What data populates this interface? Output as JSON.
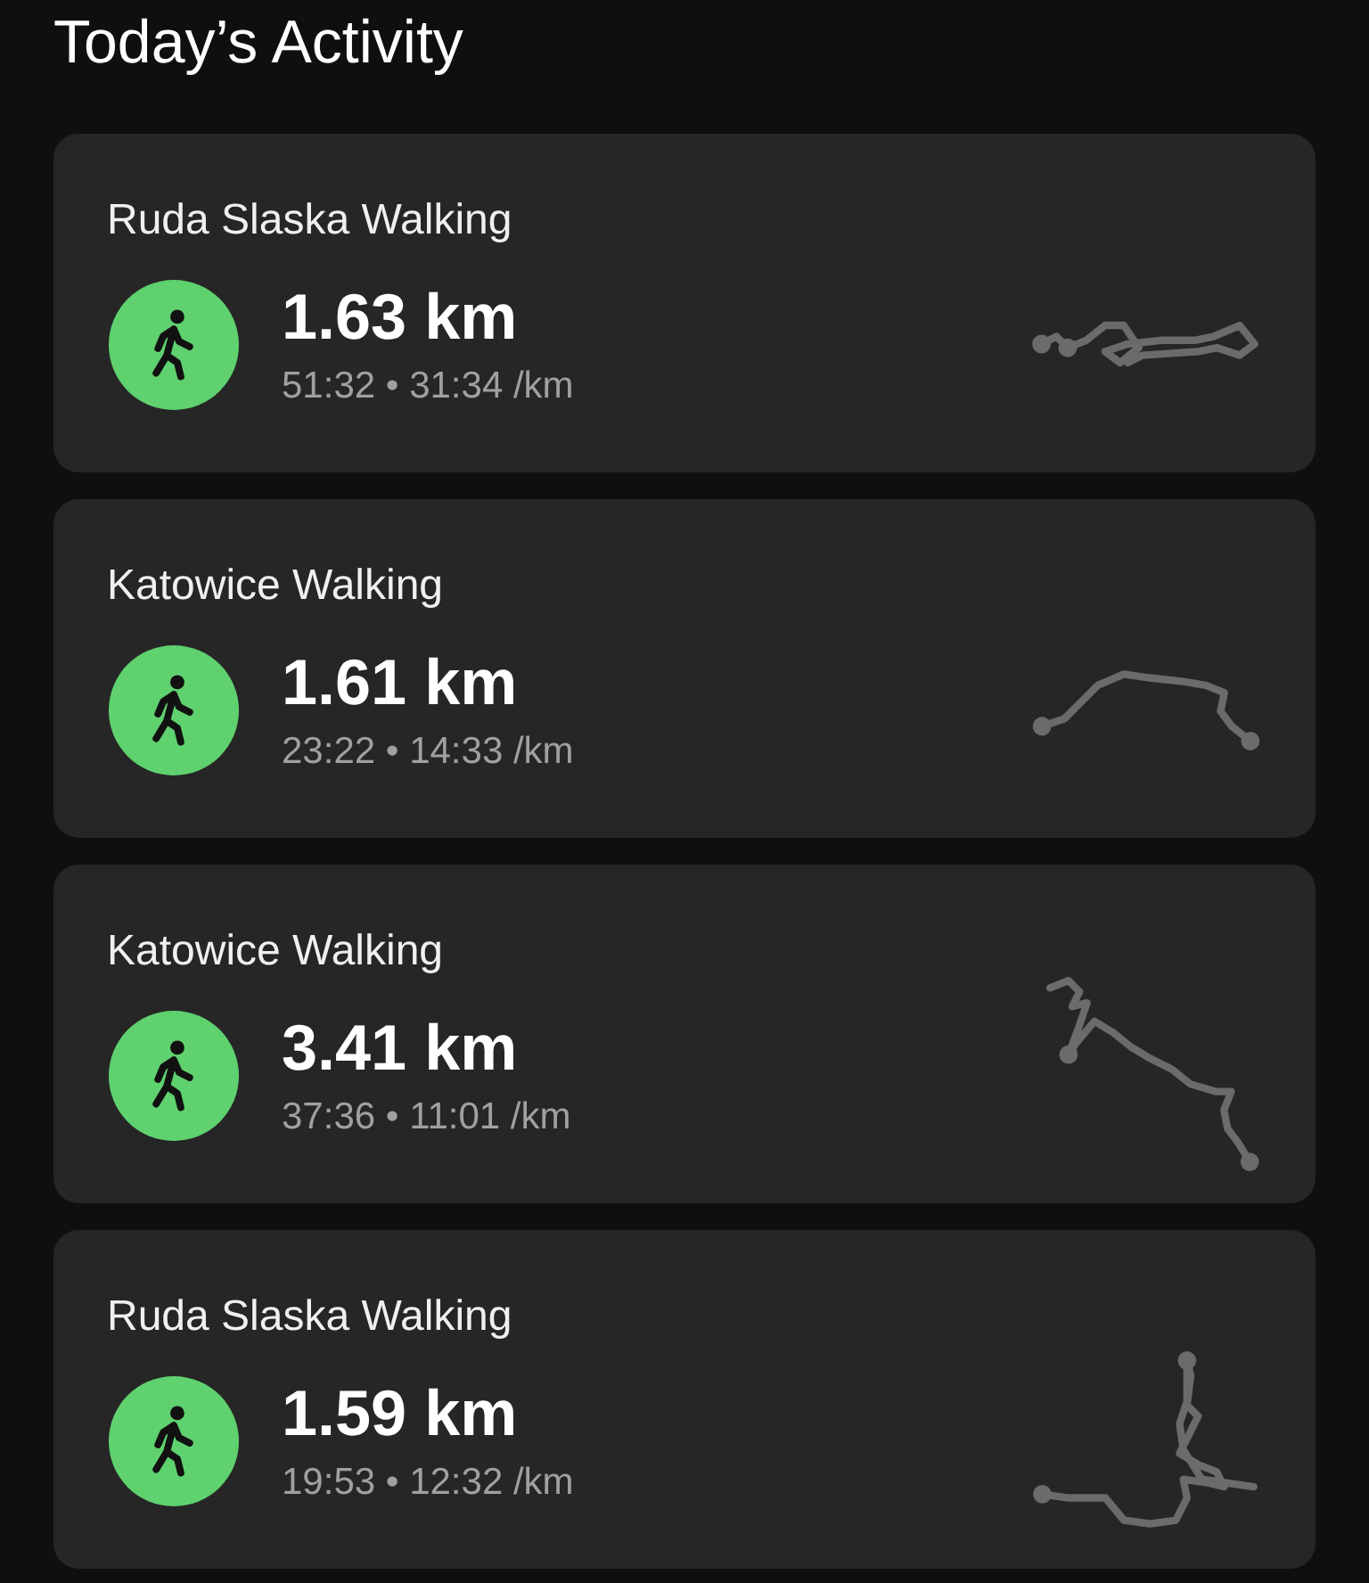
{
  "title": "Today’s Activity",
  "activities": [
    {
      "name": "Ruda Slaska Walking",
      "distance": "1.63 km",
      "details": "51:32 • 31:34 /km"
    },
    {
      "name": "Katowice Walking",
      "distance": "1.61 km",
      "details": "23:22 • 14:33 /km"
    },
    {
      "name": "Katowice Walking",
      "distance": "3.41 km",
      "details": "37:36 • 11:01 /km"
    },
    {
      "name": "Ruda Slaska Walking",
      "distance": "1.59 km",
      "details": "19:53 • 12:32 /km"
    }
  ]
}
